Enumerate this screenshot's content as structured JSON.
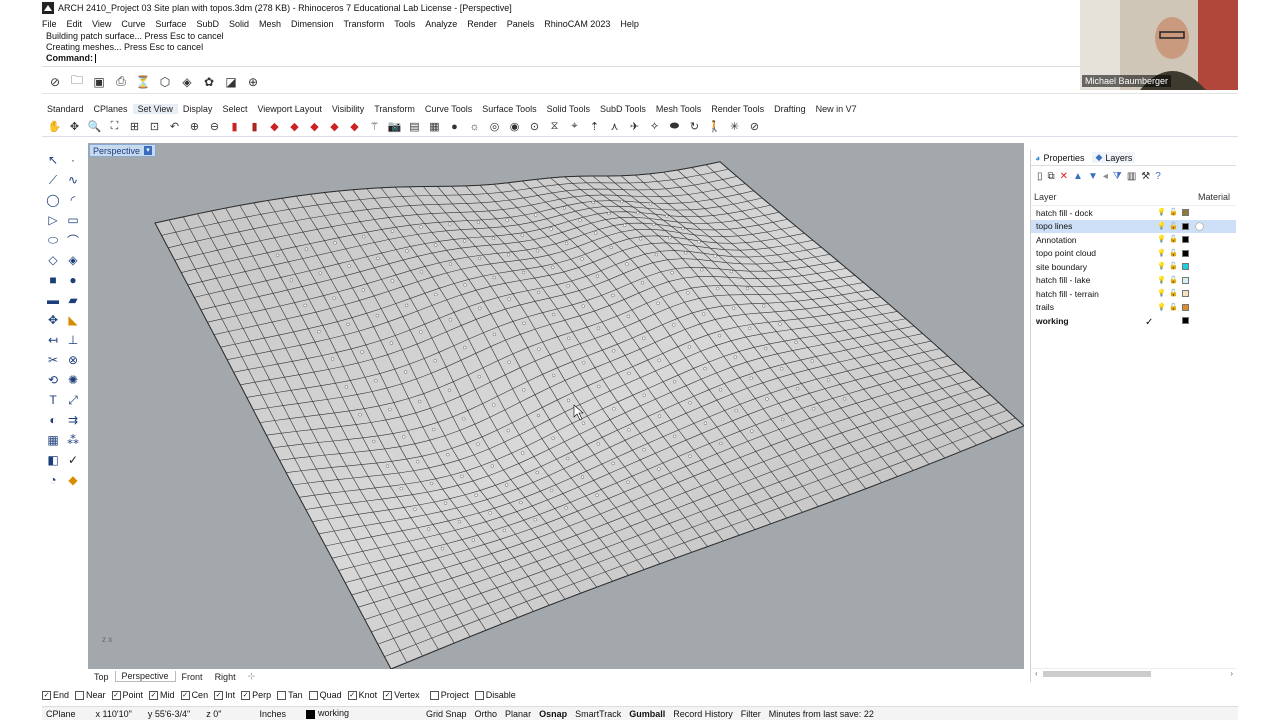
{
  "window": {
    "title": "ARCH 2410_Project 03 Site plan with topos.3dm (278 KB) - Rhinoceros 7 Educational Lab License - [Perspective]"
  },
  "menu": [
    "File",
    "Edit",
    "View",
    "Curve",
    "Surface",
    "SubD",
    "Solid",
    "Mesh",
    "Dimension",
    "Transform",
    "Tools",
    "Analyze",
    "Render",
    "Panels",
    "RhinoCAM 2023",
    "Help"
  ],
  "command": {
    "history": [
      "Building patch surface... Press Esc to cancel",
      "Creating meshes... Press Esc to cancel"
    ],
    "prompt": "Command:"
  },
  "webcam": {
    "name": "Michael Baumberger"
  },
  "tabs": [
    "Standard",
    "CPlanes",
    "Set View",
    "Display",
    "Select",
    "Viewport Layout",
    "Visibility",
    "Transform",
    "Curve Tools",
    "Surface Tools",
    "Solid Tools",
    "SubD Tools",
    "Mesh Tools",
    "Render Tools",
    "Drafting",
    "New in V7"
  ],
  "active_tab": "Set View",
  "viewport": {
    "label": "Perspective",
    "axes": "z  x"
  },
  "view_tabs": [
    "Top",
    "Perspective",
    "Front",
    "Right"
  ],
  "active_view_tab": "Perspective",
  "panel": {
    "tabs": [
      "Properties",
      "Layers"
    ],
    "header": {
      "layer": "Layer",
      "material": "Material"
    },
    "layers": [
      {
        "name": "hatch fill - dock",
        "color": "#8a7a3a"
      },
      {
        "name": "topo lines",
        "color": "#000000",
        "selected": true
      },
      {
        "name": "Annotation",
        "color": "#000000"
      },
      {
        "name": "topo point cloud",
        "color": "#000000"
      },
      {
        "name": "site boundary",
        "color": "#1ecfe0"
      },
      {
        "name": "hatch fill - lake",
        "color": "#d8f0f6"
      },
      {
        "name": "hatch fill - terrain",
        "color": "#f6e2c2"
      },
      {
        "name": "trails",
        "color": "#e08a2a"
      },
      {
        "name": "working",
        "color": "#000000",
        "current": true
      }
    ]
  },
  "osnaps": [
    {
      "label": "End",
      "checked": true
    },
    {
      "label": "Near",
      "checked": false
    },
    {
      "label": "Point",
      "checked": true
    },
    {
      "label": "Mid",
      "checked": true
    },
    {
      "label": "Cen",
      "checked": true
    },
    {
      "label": "Int",
      "checked": true
    },
    {
      "label": "Perp",
      "checked": true
    },
    {
      "label": "Tan",
      "checked": false
    },
    {
      "label": "Quad",
      "checked": false
    },
    {
      "label": "Knot",
      "checked": true
    },
    {
      "label": "Vertex",
      "checked": true
    },
    {
      "label": "Project",
      "checked": false
    },
    {
      "label": "Disable",
      "checked": false
    }
  ],
  "status": {
    "cplane": "CPlane",
    "x": "x 110'10\"",
    "y": "y 55'6-3/4\"",
    "z": "z 0\"",
    "units": "Inches",
    "layer": "working",
    "toggles": [
      "Grid Snap",
      "Ortho",
      "Planar",
      "Osnap",
      "SmartTrack",
      "Gumball",
      "Record History",
      "Filter"
    ],
    "bold_toggles": [
      "Osnap",
      "Gumball"
    ],
    "save": "Minutes from last save: 22"
  }
}
